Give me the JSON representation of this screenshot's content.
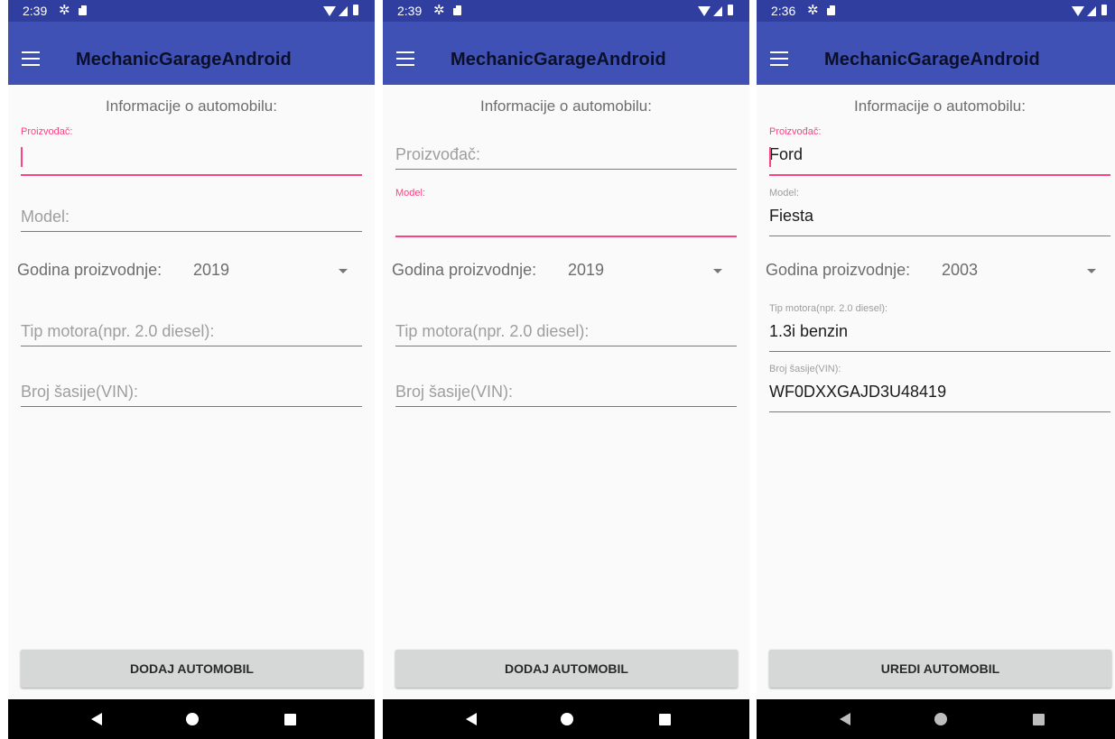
{
  "app_title": "MechanicGarageAndroid",
  "screens": [
    {
      "status_time": "2:39",
      "section_title": "Informacije o automobilu:",
      "manufacturer": {
        "label": "Proizvođač:",
        "value": ""
      },
      "model": {
        "hint": "Model:"
      },
      "year": {
        "label": "Godina proizvodnje:",
        "value": "2019"
      },
      "engine": {
        "hint": "Tip motora(npr. 2.0 diesel):"
      },
      "vin": {
        "hint": "Broj šasije(VIN):"
      },
      "button_label": "DODAJ AUTOMOBIL"
    },
    {
      "status_time": "2:39",
      "section_title": "Informacije o automobilu:",
      "manufacturer": {
        "hint": "Proizvođač:"
      },
      "model": {
        "label": "Model:",
        "value": ""
      },
      "year": {
        "label": "Godina proizvodnje:",
        "value": "2019"
      },
      "engine": {
        "hint": "Tip motora(npr. 2.0 diesel):"
      },
      "vin": {
        "hint": "Broj šasije(VIN):"
      },
      "button_label": "DODAJ AUTOMOBIL"
    },
    {
      "status_time": "2:36",
      "section_title": "Informacije o automobilu:",
      "manufacturer": {
        "label": "Proizvođač:",
        "value": "Ford"
      },
      "model": {
        "label": "Model:",
        "value": "Fiesta"
      },
      "year": {
        "label": "Godina proizvodnje:",
        "value": "2003"
      },
      "engine": {
        "label": "Tip motora(npr. 2.0 diesel):",
        "value": "1.3i benzin"
      },
      "vin": {
        "label": "Broj šasije(VIN):",
        "value": "WF0DXXGAJD3U48419"
      },
      "button_label": "UREDI AUTOMOBIL"
    }
  ],
  "icons": {
    "status": [
      "gear-icon",
      "sd-card-icon",
      "wifi-icon",
      "signal-icon",
      "battery-icon"
    ],
    "app_bar": "menu-icon",
    "nav": [
      "back-icon",
      "home-icon",
      "recents-icon"
    ]
  },
  "colors": {
    "status_bar": "#303f9f",
    "app_bar": "#3f51b5",
    "accent": "#ff4081",
    "button": "#d6d7d7"
  }
}
